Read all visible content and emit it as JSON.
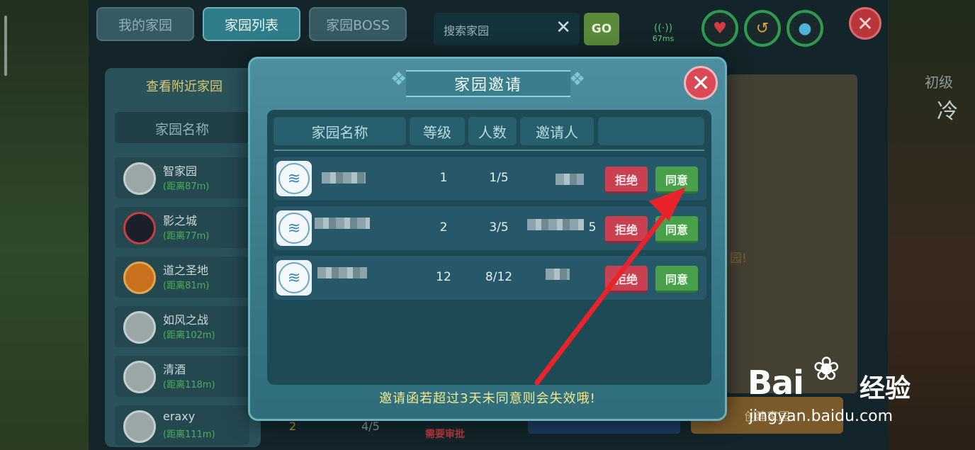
{
  "top_tabs": [
    {
      "label": "我的家园"
    },
    {
      "label": "家园列表"
    },
    {
      "label": "家园BOSS"
    }
  ],
  "search": {
    "placeholder": "搜索家园",
    "go_label": "GO"
  },
  "status": {
    "ping": "67ms"
  },
  "left_panel": {
    "title": "查看附近家园",
    "column_header": "家园名称",
    "items": [
      {
        "name": "智家园",
        "distance": "(距离87m)"
      },
      {
        "name": "影之城",
        "distance": "(距离77m)"
      },
      {
        "name": "道之圣地",
        "distance": "(距离81m)"
      },
      {
        "name": "如风之战",
        "distance": "(距离102m)"
      },
      {
        "name": "清酒",
        "distance": "(距离118m)"
      },
      {
        "name": "eraxy",
        "distance": "(距离111m)"
      }
    ]
  },
  "background_fragments": {
    "level": "2",
    "count": "4/5",
    "need_approval": "需要审批",
    "right_note": "园!",
    "create_button": "创建家园",
    "right_top_a": "初级",
    "right_top_b": "冷"
  },
  "modal": {
    "title": "家园邀请",
    "columns": [
      "家园名称",
      "等级",
      "人数",
      "邀请人",
      ""
    ],
    "rows": [
      {
        "level": "1",
        "members": "1/5",
        "inviter_suffix": "",
        "reject": "拒绝",
        "accept": "同意"
      },
      {
        "level": "2",
        "members": "3/5",
        "inviter_suffix": "5",
        "reject": "拒绝",
        "accept": "同意"
      },
      {
        "level": "12",
        "members": "8/12",
        "inviter_suffix": "",
        "reject": "拒绝",
        "accept": "同意"
      }
    ],
    "notice": "邀请函若超过3天未同意则会失效哦!"
  },
  "watermark": {
    "brand": "Bai",
    "brand_suffix": "经验",
    "url": "jingyan.baidu.com"
  },
  "colors": {
    "accent_green": "#48a04a",
    "reject_red": "#c94150",
    "arrow_red": "#e8232b"
  },
  "icons": {
    "close": "close-icon",
    "heart": "heart-icon",
    "drop": "water-drop-icon",
    "fish": "fish-avatar-icon"
  }
}
